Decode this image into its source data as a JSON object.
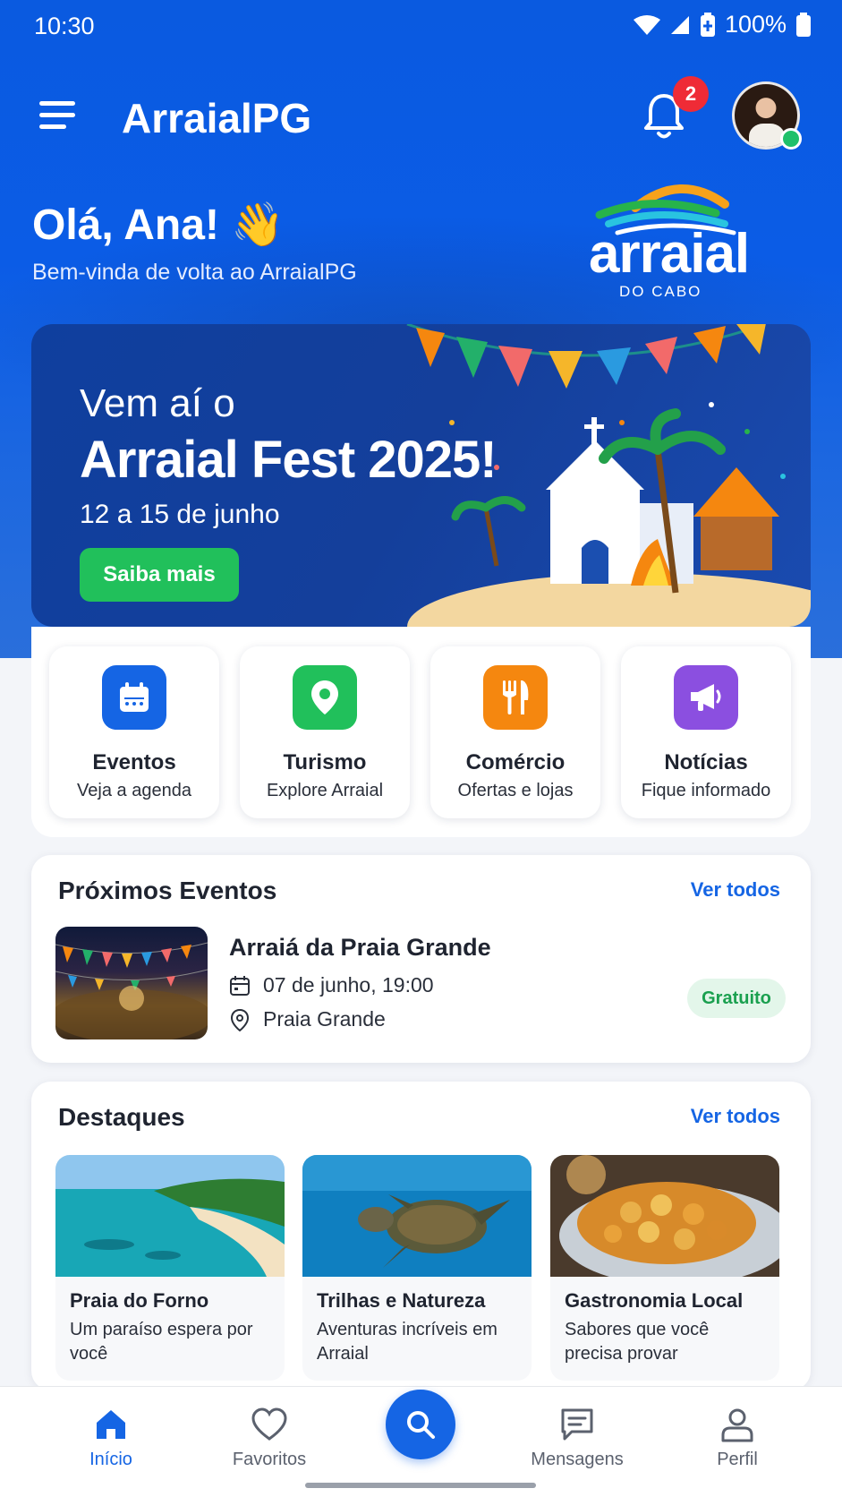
{
  "status_bar": {
    "time": "10:30",
    "battery": "100%"
  },
  "header": {
    "app_title": "ArraialPG",
    "notification_count": "2"
  },
  "greeting": {
    "title": "Olá, Ana! 👋",
    "subtitle": "Bem-vinda de volta ao ArraialPG"
  },
  "logo": {
    "word": "arraial",
    "tagline": "DO CABO"
  },
  "banner": {
    "line1": "Vem aí o",
    "line2": "Arraial Fest 2025!",
    "dates": "12 a 15 de junho",
    "cta": "Saiba mais"
  },
  "quick_actions": [
    {
      "title": "Eventos",
      "subtitle": "Veja a agenda",
      "icon": "calendar-icon",
      "color": "#1565e4"
    },
    {
      "title": "Turismo",
      "subtitle": "Explore Arraial",
      "icon": "map-pin-icon",
      "color": "#21c05b"
    },
    {
      "title": "Comércio",
      "subtitle": "Ofertas e lojas",
      "icon": "fork-knife-icon",
      "color": "#f5870f"
    },
    {
      "title": "Notícias",
      "subtitle": "Fique informado",
      "icon": "megaphone-icon",
      "color": "#8b4fe0"
    }
  ],
  "events": {
    "heading": "Próximos Eventos",
    "see_all": "Ver todos",
    "item": {
      "title": "Arraiá da Praia Grande",
      "date": "07 de junho, 19:00",
      "location": "Praia Grande",
      "price": "Gratuito"
    }
  },
  "highlights": {
    "heading": "Destaques",
    "see_all": "Ver todos",
    "items": [
      {
        "title": "Praia do Forno",
        "desc": "Um paraíso espera por você"
      },
      {
        "title": "Trilhas e Natureza",
        "desc": "Aventuras incríveis em Arraial"
      },
      {
        "title": "Gastronomia Local",
        "desc": "Sabores que você precisa provar"
      }
    ]
  },
  "nav": {
    "home": "Início",
    "favorites": "Favoritos",
    "messages": "Mensagens",
    "profile": "Perfil"
  },
  "colors": {
    "primary": "#1565e4",
    "success": "#21c05b",
    "badge": "#ef2b36"
  }
}
